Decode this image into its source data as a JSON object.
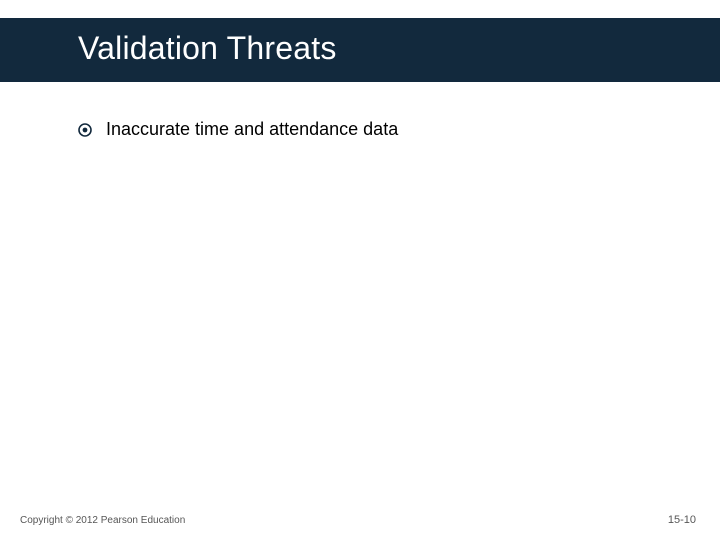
{
  "title": "Validation Threats",
  "bullets": [
    {
      "text": "Inaccurate time and attendance data"
    }
  ],
  "footer": {
    "copyright": "Copyright © 2012 Pearson Education",
    "page": "15-10"
  },
  "colors": {
    "band": "#12293d",
    "bullet": "#12293d"
  }
}
